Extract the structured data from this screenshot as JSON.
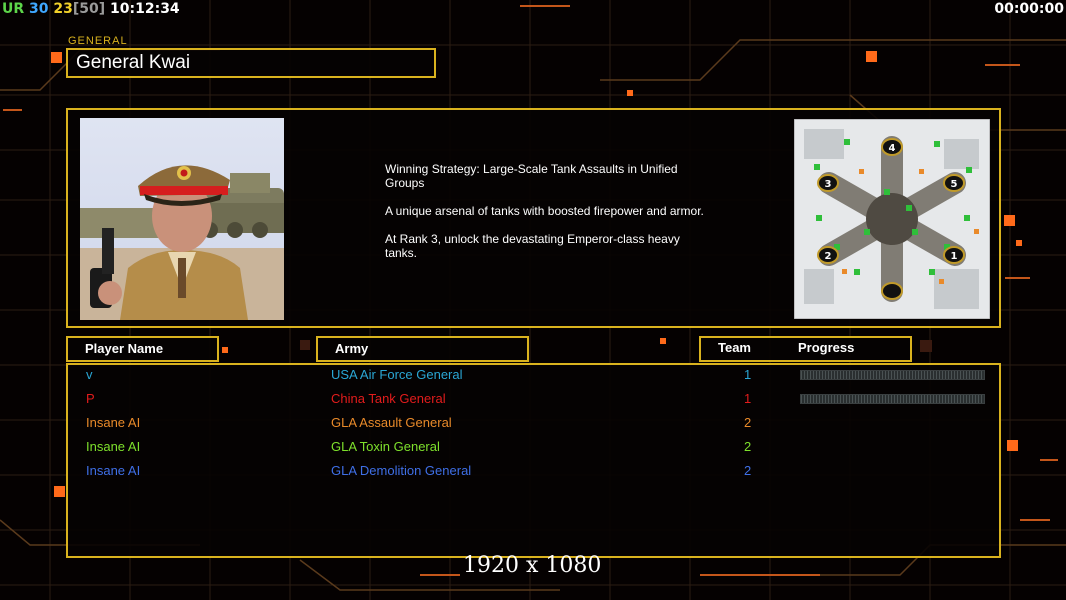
{
  "hud": {
    "faction": "UR",
    "val1": "30",
    "val2": "23",
    "val3": "[50]",
    "clock": "10:12:34",
    "game_timer": "00:00:00"
  },
  "general": {
    "tag": "GENERAL",
    "name": "General Kwai",
    "strategy": "Winning Strategy: Large-Scale Tank Assaults in Unified Groups",
    "desc1": "A unique arsenal of tanks with boosted firepower and armor.",
    "desc2": "At Rank 3, unlock the devastating Emperor-class heavy tanks."
  },
  "map": {
    "slots": [
      "1",
      "2",
      "3",
      "4",
      "5"
    ]
  },
  "table": {
    "headers": {
      "player": "Player Name",
      "army": "Army",
      "team": "Team",
      "progress": "Progress"
    },
    "rows": [
      {
        "player": "v",
        "army": "USA Air Force General",
        "team": "1",
        "color": "#2aa6d4",
        "progress": 0.0,
        "show_progress": true
      },
      {
        "player": "P",
        "army": "China Tank General",
        "team": "1",
        "color": "#e21c1c",
        "progress": 0.0,
        "show_progress": true
      },
      {
        "player": "Insane AI",
        "army": "GLA Assault General",
        "team": "2",
        "color": "#e98a2a",
        "show_progress": false
      },
      {
        "player": "Insane AI",
        "army": "GLA Toxin General",
        "team": "2",
        "color": "#7ee02c",
        "show_progress": false
      },
      {
        "player": "Insane AI",
        "army": "GLA Demolition General",
        "team": "2",
        "color": "#3f6fe6",
        "show_progress": false
      }
    ]
  },
  "overlay": {
    "resolution": "1920 x 1080"
  },
  "colors": {
    "frame": "#d9b21e",
    "accent_orange": "#ff6a1a"
  }
}
